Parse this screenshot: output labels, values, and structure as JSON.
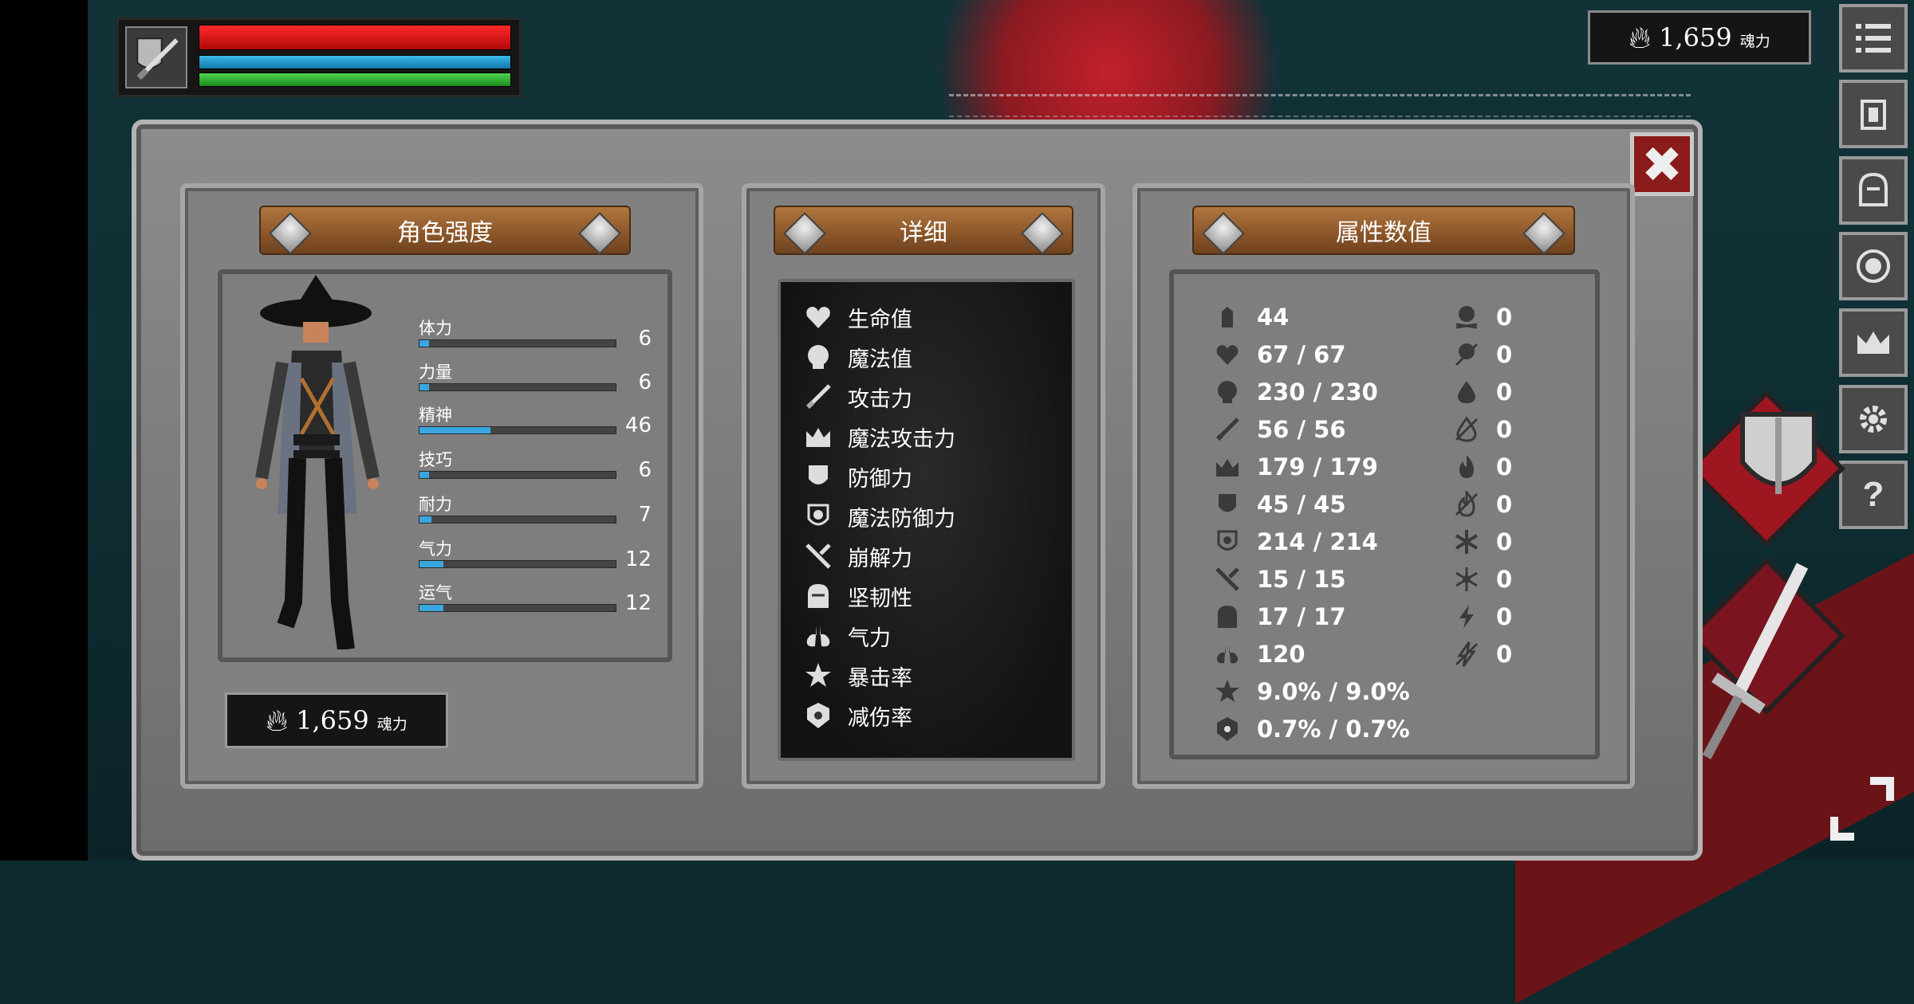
{
  "hud": {
    "souls_value": "1,659",
    "souls_unit": "魂力"
  },
  "character_panel": {
    "title": "角色强度",
    "stats": [
      {
        "label": "体力",
        "value": "6",
        "fill": 0.05
      },
      {
        "label": "力量",
        "value": "6",
        "fill": 0.05
      },
      {
        "label": "精神",
        "value": "46",
        "fill": 0.36
      },
      {
        "label": "技巧",
        "value": "6",
        "fill": 0.05
      },
      {
        "label": "耐力",
        "value": "7",
        "fill": 0.06
      },
      {
        "label": "气力",
        "value": "12",
        "fill": 0.12
      },
      {
        "label": "运气",
        "value": "12",
        "fill": 0.12
      }
    ],
    "souls_value": "1,659",
    "souls_unit": "魂力"
  },
  "detail_panel": {
    "title": "详细",
    "items": [
      {
        "label": "生命值",
        "icon": "heart-icon"
      },
      {
        "label": "魔法值",
        "icon": "head-icon"
      },
      {
        "label": "攻击力",
        "icon": "sword-icon"
      },
      {
        "label": "魔法攻击力",
        "icon": "crown-spell-icon"
      },
      {
        "label": "防御力",
        "icon": "shield-icon"
      },
      {
        "label": "魔法防御力",
        "icon": "magic-shield-icon"
      },
      {
        "label": "崩解力",
        "icon": "break-icon"
      },
      {
        "label": "坚韧性",
        "icon": "helmet-icon"
      },
      {
        "label": "气力",
        "icon": "lungs-icon"
      },
      {
        "label": "暴击率",
        "icon": "star-icon"
      },
      {
        "label": "减伤率",
        "icon": "badge-icon"
      }
    ]
  },
  "attribute_panel": {
    "title": "属性数值",
    "left_values": [
      {
        "icon": "weight-icon",
        "value": "44"
      },
      {
        "icon": "heart-icon",
        "value": "67 / 67"
      },
      {
        "icon": "head-icon",
        "value": "230 / 230"
      },
      {
        "icon": "sword-icon",
        "value": "56 / 56"
      },
      {
        "icon": "crown-spell-icon",
        "value": "179 / 179"
      },
      {
        "icon": "shield-icon",
        "value": "45 / 45"
      },
      {
        "icon": "magic-shield-icon",
        "value": "214 / 214"
      },
      {
        "icon": "break-icon",
        "value": "15 / 15"
      },
      {
        "icon": "helmet-icon",
        "value": "17 / 17"
      },
      {
        "icon": "lungs-icon",
        "value": "120"
      },
      {
        "icon": "star-icon",
        "value": "9.0% / 9.0%"
      },
      {
        "icon": "badge-icon",
        "value": "0.7% / 0.7%"
      }
    ],
    "right_values": [
      {
        "icon": "skull-icon",
        "value": "0"
      },
      {
        "icon": "poison-skull-icon",
        "value": "0"
      },
      {
        "icon": "blood-drop-icon",
        "value": "0"
      },
      {
        "icon": "bleed-resist-icon",
        "value": "0"
      },
      {
        "icon": "fire-icon",
        "value": "0"
      },
      {
        "icon": "fire-resist-icon",
        "value": "0"
      },
      {
        "icon": "frost-icon",
        "value": "0"
      },
      {
        "icon": "frost-resist-icon",
        "value": "0"
      },
      {
        "icon": "lightning-icon",
        "value": "0"
      },
      {
        "icon": "lightning-resist-icon",
        "value": "0"
      }
    ]
  },
  "colors": {
    "hp": "#e01818",
    "mp": "#2596c8",
    "stamina": "#2fb82f",
    "stat_fill": "#3aa6e0",
    "close": "#8b1a1a"
  }
}
